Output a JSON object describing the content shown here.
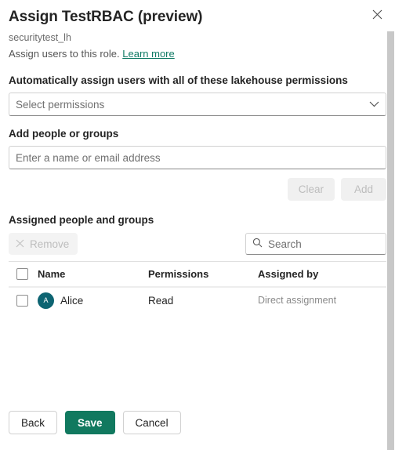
{
  "dialog": {
    "title": "Assign TestRBAC (preview)",
    "subtitle": "securitytest_lh",
    "description": "Assign users to this role.",
    "learn_more": "Learn more",
    "close_icon": "close-icon"
  },
  "auto_assign": {
    "label": "Automatically assign users with all of these lakehouse permissions",
    "placeholder": "Select permissions",
    "value": "",
    "chevron_icon": "chevron-down-icon"
  },
  "add_people": {
    "label": "Add people or groups",
    "placeholder": "Enter a name or email address",
    "value": "",
    "clear_label": "Clear",
    "add_label": "Add"
  },
  "assigned": {
    "label": "Assigned people and groups",
    "remove_label": "Remove",
    "remove_icon": "close-icon",
    "search_placeholder": "Search",
    "search_value": "",
    "search_icon": "search-icon",
    "columns": [
      "Name",
      "Permissions",
      "Assigned by"
    ],
    "rows": [
      {
        "initial": "A",
        "name": "Alice",
        "permissions": "Read",
        "assigned_by": "Direct assignment"
      }
    ]
  },
  "footer": {
    "back_label": "Back",
    "save_label": "Save",
    "cancel_label": "Cancel"
  },
  "colors": {
    "accent_green": "#11795f",
    "link_green": "#0f7a64",
    "avatar_teal": "#0d6472"
  }
}
